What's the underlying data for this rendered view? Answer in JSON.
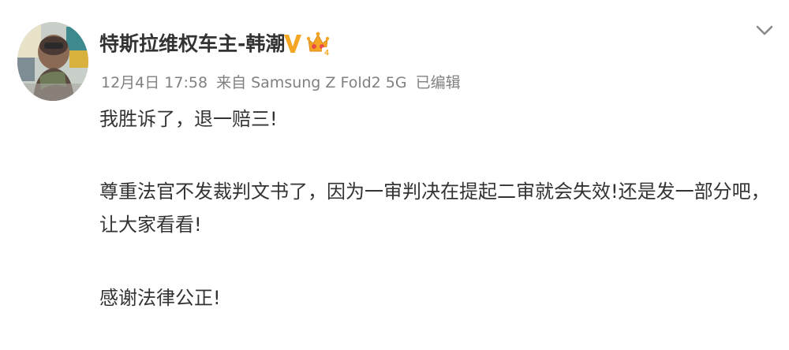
{
  "post": {
    "username": "特斯拉维权车主-韩潮",
    "verified_badge_icon": "verified-v-icon",
    "level_badge_icon": "crown-level-icon",
    "level_badge_colors": {
      "crown": "#f4a623",
      "gem": "#e94b4b",
      "v": "#f5a623"
    },
    "date": "12月4日 17:58",
    "source": "来自 Samsung Z Fold2 5G",
    "edited": "已编辑",
    "menu_icon": "chevron-down-icon",
    "content": {
      "line1": "我胜诉了，退一赔三!",
      "line2": "尊重法官不发裁判文书了，因为一审判决在提起二审就会失效!还是发一部分吧，",
      "line3": "让大家看看!",
      "line4": "感谢法律公正!"
    }
  }
}
